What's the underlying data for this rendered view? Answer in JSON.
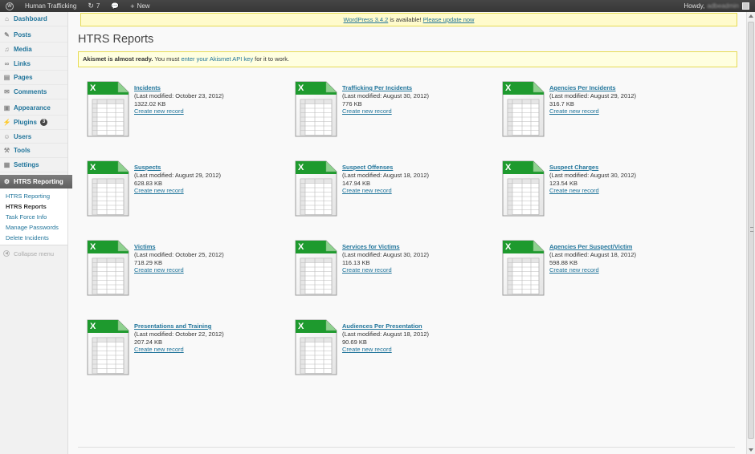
{
  "admin_bar": {
    "site_name": "Human Trafficking",
    "updates_count": "7",
    "new_label": "New",
    "howdy": "Howdy,",
    "username": "adbeadmin"
  },
  "sidebar": {
    "items_top": [
      {
        "label": "Dashboard",
        "icon": "dashboard-icon",
        "glyph": "⌂"
      }
    ],
    "items_content": [
      {
        "label": "Posts",
        "icon": "pin-icon",
        "glyph": "✎"
      },
      {
        "label": "Media",
        "icon": "media-icon",
        "glyph": "♫"
      },
      {
        "label": "Links",
        "icon": "link-icon",
        "glyph": "∞"
      },
      {
        "label": "Pages",
        "icon": "page-icon",
        "glyph": "▤"
      },
      {
        "label": "Comments",
        "icon": "comment-icon",
        "glyph": "✉"
      }
    ],
    "items_admin": [
      {
        "label": "Appearance",
        "icon": "appearance-icon",
        "glyph": "▣"
      },
      {
        "label": "Plugins",
        "icon": "plugin-icon",
        "glyph": "⚡",
        "badge": "3"
      },
      {
        "label": "Users",
        "icon": "users-icon",
        "glyph": "☺"
      },
      {
        "label": "Tools",
        "icon": "tools-icon",
        "glyph": "⚒"
      },
      {
        "label": "Settings",
        "icon": "settings-icon",
        "glyph": "▦"
      }
    ],
    "current": {
      "label": "HTRS Reporting",
      "icon": "gear-icon",
      "glyph": "⚙"
    },
    "submenu": [
      {
        "label": "HTRS Reporting",
        "current": false
      },
      {
        "label": "HTRS Reports",
        "current": true
      },
      {
        "label": "Task Force Info",
        "current": false
      },
      {
        "label": "Manage Passwords",
        "current": false
      },
      {
        "label": "Delete Incidents",
        "current": false
      }
    ],
    "collapse_label": "Collapse menu"
  },
  "update_notice": {
    "link_version": "WordPress 3.4.2",
    "middle": "is available!",
    "link_update": "Please update now"
  },
  "page_title": "HTRS Reports",
  "akismet": {
    "bold": "Akismet is almost ready.",
    "pre": "You must",
    "link": "enter your Akismet API key",
    "post": "for it to work."
  },
  "reports": [
    {
      "title": "Incidents",
      "modified": "(Last modified: October 23, 2012)",
      "size": "1322.02 KB",
      "create": "Create new record"
    },
    {
      "title": "Trafficking Per Incidents",
      "modified": "(Last modified: August 30, 2012)",
      "size": "776 KB",
      "create": "Create new record"
    },
    {
      "title": "Agencies Per Incidents",
      "modified": "(Last modified: August 29, 2012)",
      "size": "316.7 KB",
      "create": "Create new record"
    },
    {
      "title": "Suspects",
      "modified": "(Last modified: August 29, 2012)",
      "size": "628.83 KB",
      "create": "Create new record"
    },
    {
      "title": "Suspect Offenses",
      "modified": "(Last modified: August 18, 2012)",
      "size": "147.94 KB",
      "create": "Create new record"
    },
    {
      "title": "Suspect Charges",
      "modified": "(Last modified: August 30, 2012)",
      "size": "123.54 KB",
      "create": "Create new record"
    },
    {
      "title": "Victims",
      "modified": "(Last modified: October 25, 2012)",
      "size": "718.29 KB",
      "create": "Create new record"
    },
    {
      "title": "Services for Victims",
      "modified": "(Last modified: August 30, 2012)",
      "size": "116.13 KB",
      "create": "Create new record"
    },
    {
      "title": "Agencies Per Suspect/Victim",
      "modified": "(Last modified: August 18, 2012)",
      "size": "598.88 KB",
      "create": "Create new record"
    },
    {
      "title": "Presentations and Training",
      "modified": "(Last modified: October 22, 2012)",
      "size": "207.24 KB",
      "create": "Create new record"
    },
    {
      "title": "Audiences Per Presentation",
      "modified": "(Last modified: August 18, 2012)",
      "size": "90.69 KB",
      "create": "Create new record"
    }
  ],
  "colors": {
    "link": "#21759b",
    "excel_green": "#1e9a2e",
    "admin_bar": "#464646"
  }
}
